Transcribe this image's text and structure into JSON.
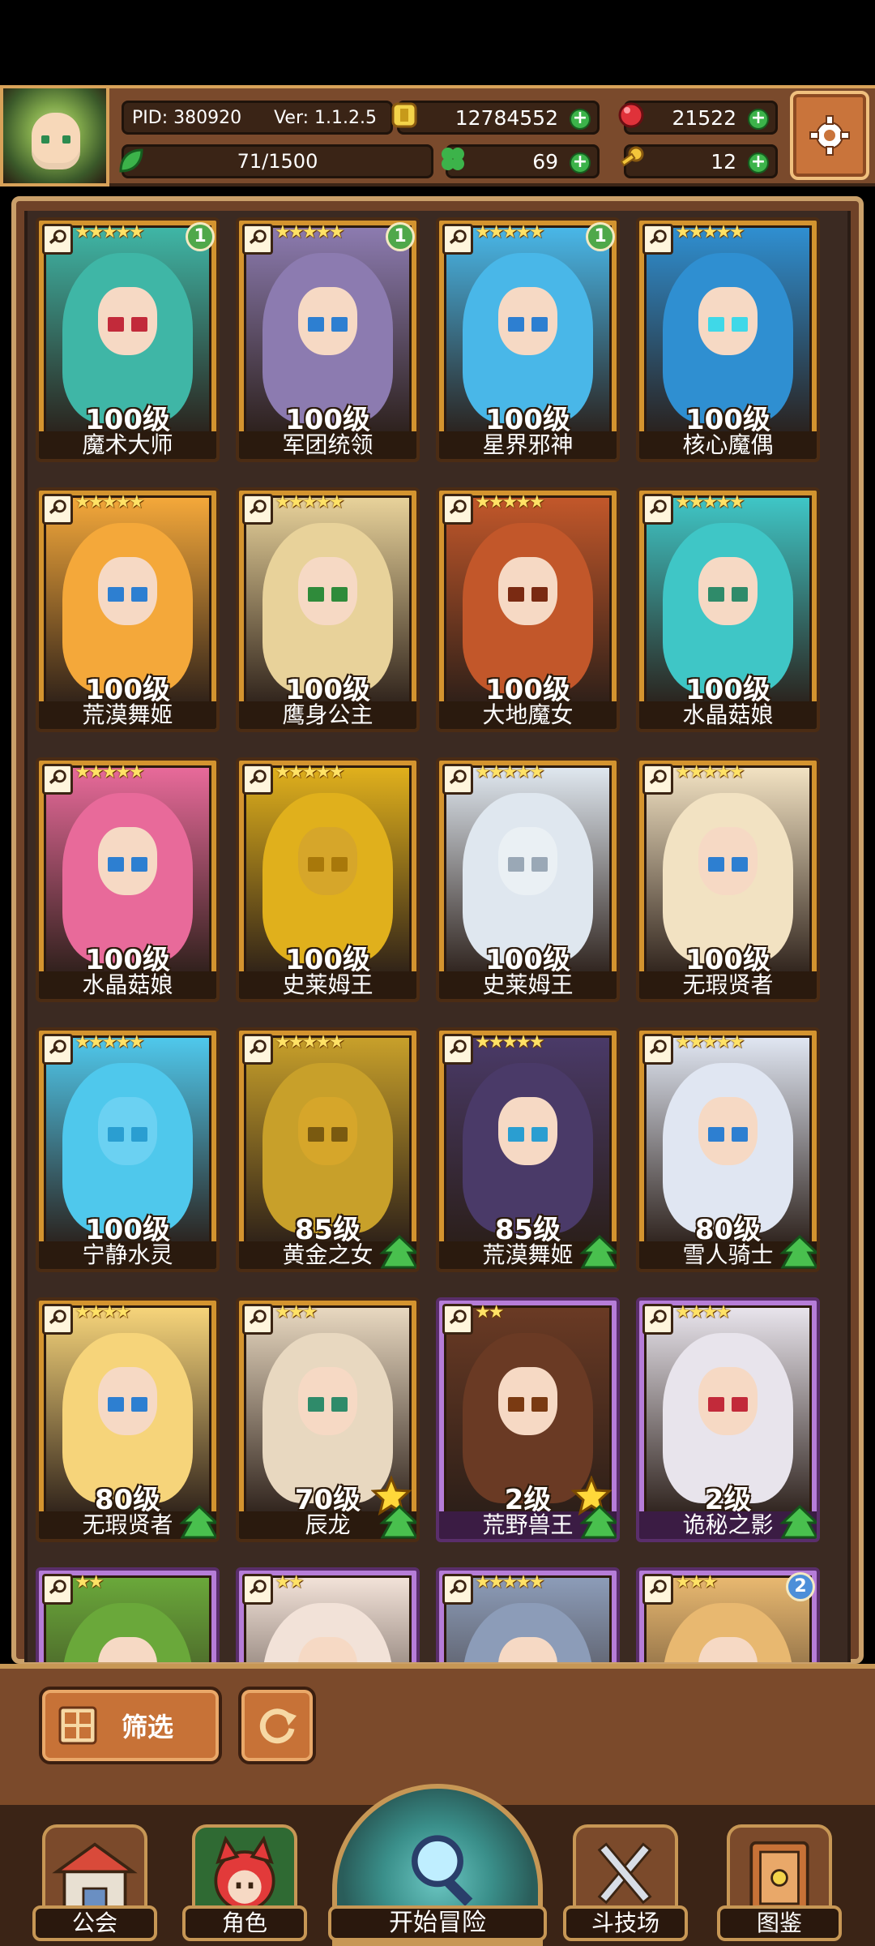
{
  "header": {
    "pid": "PID: 380920",
    "version": "Ver: 1.1.2.5",
    "gold": "12784552",
    "gems": "21522",
    "stamina": "71/1500",
    "clover": "69",
    "keys": "12"
  },
  "cards": [
    {
      "level": "100级",
      "name": "魔术大师",
      "stars": "★★★★★",
      "badge": "1",
      "hair": "#3fb6a6",
      "eye": "#c22a3a",
      "frame": "orange"
    },
    {
      "level": "100级",
      "name": "军团统领",
      "stars": "★★★★★",
      "badge": "1",
      "hair": "#8c7bb0",
      "eye": "#2d7fd1",
      "frame": "orange"
    },
    {
      "level": "100级",
      "name": "星界邪神",
      "stars": "★★★★★",
      "badge": "1",
      "hair": "#49b7e8",
      "eye": "#2d7fd1",
      "frame": "orange"
    },
    {
      "level": "100级",
      "name": "核心魔偶",
      "stars": "★★★★★",
      "badge": "",
      "hair": "#2f8fd1",
      "eye": "#3fd8e8",
      "frame": "orange"
    },
    {
      "level": "100级",
      "name": "荒漠舞姬",
      "stars": "★★★★★",
      "badge": "",
      "hair": "#f4a83a",
      "eye": "#2d7fd1",
      "frame": "orange"
    },
    {
      "level": "100级",
      "name": "鹰身公主",
      "stars": "★★★★★",
      "badge": "",
      "hair": "#e8d29a",
      "eye": "#2f8b3a",
      "frame": "orange"
    },
    {
      "level": "100级",
      "name": "大地魔女",
      "stars": "★★★★★",
      "badge": "",
      "hair": "#c2572a",
      "eye": "#7a2a12",
      "frame": "orange"
    },
    {
      "level": "100级",
      "name": "水晶菇娘",
      "stars": "★★★★★",
      "badge": "",
      "hair": "#3fc6c6",
      "eye": "#2f8b6a",
      "frame": "orange"
    },
    {
      "level": "100级",
      "name": "水晶菇娘",
      "stars": "★★★★★",
      "badge": "",
      "hair": "#e86a9a",
      "eye": "#2d7fd1",
      "frame": "orange"
    },
    {
      "level": "100级",
      "name": "史莱姆王",
      "stars": "★★★★★",
      "badge": "",
      "hair": "#e0b01c",
      "eye": "#a8780a",
      "frame": "orange",
      "face": "gold"
    },
    {
      "level": "100级",
      "name": "史莱姆王",
      "stars": "★★★★★",
      "badge": "",
      "hair": "#dfe7ef",
      "eye": "#9aa8b6",
      "frame": "orange",
      "face": "white"
    },
    {
      "level": "100级",
      "name": "无瑕贤者",
      "stars": "★★★★★",
      "badge": "",
      "hair": "#f2e2c2",
      "eye": "#2d7fd1",
      "frame": "orange"
    },
    {
      "level": "100级",
      "name": "宁静水灵",
      "stars": "★★★★★",
      "badge": "",
      "hair": "#4fc8ec",
      "eye": "#2a9ed1",
      "frame": "orange",
      "face": "blue"
    },
    {
      "level": "85级",
      "name": "黄金之女",
      "stars": "★★★★★",
      "badge": "",
      "hair": "#c8a02a",
      "eye": "#7a5a10",
      "frame": "orange",
      "face": "gold",
      "up": true
    },
    {
      "level": "85级",
      "name": "荒漠舞姬",
      "stars": "★★★★★",
      "badge": "",
      "hair": "#4a3a68",
      "eye": "#2a9ed1",
      "frame": "orange",
      "up": true
    },
    {
      "level": "80级",
      "name": "雪人骑士",
      "stars": "★★★★★",
      "badge": "",
      "hair": "#e0e6f2",
      "eye": "#2d7fd1",
      "frame": "orange",
      "up": true
    },
    {
      "level": "80级",
      "name": "无瑕贤者",
      "stars": "★★★★",
      "badge": "",
      "hair": "#f6d47a",
      "eye": "#2d7fd1",
      "frame": "orange",
      "up": true
    },
    {
      "level": "70级",
      "name": "辰龙",
      "stars": "★★★",
      "badge": "",
      "hair": "#e8d8c0",
      "eye": "#2f8b6a",
      "frame": "orange",
      "up": true,
      "star": true
    },
    {
      "level": "2级",
      "name": "荒野兽王",
      "stars": "★★",
      "badge": "",
      "hair": "#6a3a24",
      "eye": "#7a3a12",
      "frame": "purple",
      "up": true,
      "star": true
    },
    {
      "level": "2级",
      "name": "诡秘之影",
      "stars": "★★★★",
      "badge": "",
      "hair": "#e8e4ec",
      "eye": "#c22a3a",
      "frame": "purple",
      "up": true
    },
    {
      "level": "",
      "name": "",
      "stars": "★★",
      "badge": "",
      "hair": "#6aa83a",
      "eye": "#2f8b3a",
      "frame": "purple"
    },
    {
      "level": "",
      "name": "",
      "stars": "★★",
      "badge": "",
      "hair": "#f2e2d8",
      "eye": "#c22a3a",
      "frame": "purple"
    },
    {
      "level": "",
      "name": "",
      "stars": "★★★★★",
      "badge": "",
      "hair": "#8c9cb8",
      "eye": "#c22a3a",
      "frame": "purple"
    },
    {
      "level": "",
      "name": "",
      "stars": "★★★",
      "badge": "2",
      "hair": "#e8b870",
      "eye": "#7a4a12",
      "frame": "purple"
    }
  ],
  "controls": {
    "filter_label": "筛选"
  },
  "nav": {
    "guild": "公会",
    "character": "角色",
    "adventure": "开始冒险",
    "arena": "斗技场",
    "codex": "图鉴"
  }
}
